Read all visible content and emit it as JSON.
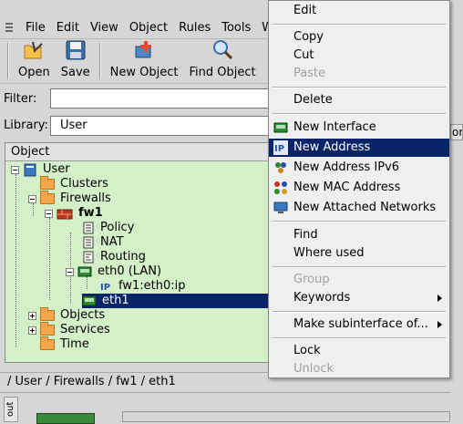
{
  "menubar": {
    "items": [
      {
        "label": "File"
      },
      {
        "label": "Edit"
      },
      {
        "label": "View"
      },
      {
        "label": "Object"
      },
      {
        "label": "Rules"
      },
      {
        "label": "Tools"
      },
      {
        "label": "Wind"
      }
    ]
  },
  "toolbar": {
    "open_label": "Open",
    "save_label": "Save",
    "new_object_label": "New Object",
    "find_object_label": "Find Object"
  },
  "filter": {
    "label": "Filter:",
    "value": ""
  },
  "library": {
    "label": "Library:",
    "value": "User"
  },
  "tree": {
    "header": "Object",
    "user": "User",
    "clusters": "Clusters",
    "firewalls": "Firewalls",
    "fw1": "fw1",
    "policy": "Policy",
    "nat": "NAT",
    "routing": "Routing",
    "eth0": "eth0 (LAN)",
    "eth0_addr": "fw1:eth0:ip",
    "eth1": "eth1",
    "objects": "Objects",
    "services": "Services",
    "time": "Time"
  },
  "status_path": "/ User / Firewalls / fw1 / eth1",
  "bottom_tab": "out",
  "right_edge_label": "or",
  "context_menu": {
    "edit": "Edit",
    "copy": "Copy",
    "cut": "Cut",
    "paste": "Paste",
    "delete": "Delete",
    "new_interface": "New Interface",
    "new_address": "New Address",
    "new_address_ipv6": "New Address IPv6",
    "new_mac_address": "New MAC Address",
    "new_attached_networks": "New Attached Networks",
    "find": "Find",
    "where_used": "Where used",
    "group": "Group",
    "keywords": "Keywords",
    "make_subinterface": "Make subinterface of...",
    "lock": "Lock",
    "unlock": "Unlock"
  },
  "colors": {
    "selection": "#0a246a",
    "tree_background": "#d4f0c8",
    "folder": "#f4a64a"
  }
}
